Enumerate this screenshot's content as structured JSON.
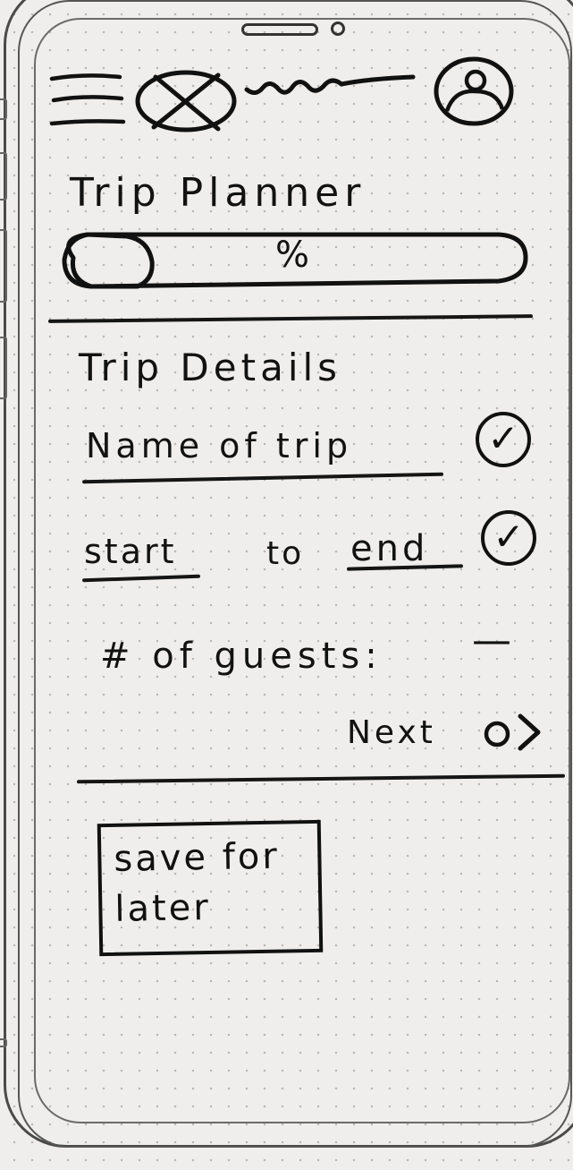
{
  "header": {
    "icons": [
      "menu-icon",
      "globe-icon",
      "profile-icon"
    ]
  },
  "page": {
    "title": "Trip Planner",
    "progress_symbol": "%"
  },
  "trip_details": {
    "heading": "Trip Details",
    "name_label": "Name of trip",
    "dates": {
      "start": "start",
      "connector": "to",
      "end": "end"
    },
    "guests_label": "# of guests:",
    "guests_value": "—",
    "next_label": "Next",
    "check_glyph": "✓"
  },
  "save_button": {
    "label": "save for\nlater"
  }
}
